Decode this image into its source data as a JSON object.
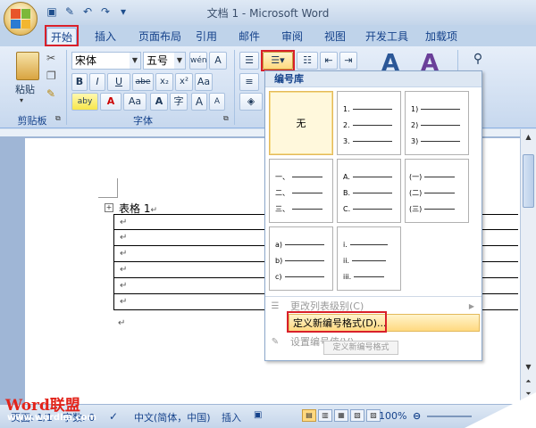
{
  "title": "文档 1 - Microsoft Word",
  "tabs": [
    "开始",
    "插入",
    "页面布局",
    "引用",
    "邮件",
    "审阅",
    "视图",
    "开发工具",
    "加载项"
  ],
  "ribbon": {
    "clipboard": {
      "paste_label": "粘贴",
      "group_label": "剪贴板"
    },
    "font": {
      "font_name": "宋体",
      "font_size": "五号",
      "font_size_menu": "五",
      "bold": "B",
      "italic": "I",
      "underline": "U",
      "strike": "abe",
      "subscript": "x₂",
      "superscript": "x²",
      "clear_format": "Aa",
      "char_border": "A",
      "enclose": "字",
      "grow": "A",
      "shrink": "A",
      "phonetic": "wén",
      "font_color": "A",
      "highlight": "aby",
      "group_label": "字体"
    }
  },
  "dropdown": {
    "header": "编号库",
    "none_label": "无",
    "tiles": [
      [
        "1.",
        "2.",
        "3."
      ],
      [
        "1)",
        "2)",
        "3)"
      ],
      [
        "一、",
        "二、",
        "三、"
      ],
      [
        "A.",
        "B.",
        "C."
      ],
      [
        "(一)",
        "(二)",
        "(三)"
      ],
      [
        "a)",
        "b)",
        "c)"
      ],
      [
        "i.",
        "ii.",
        "iii."
      ]
    ],
    "change_level": "更改列表级别(C)",
    "define_new": "定义新编号格式(D)...",
    "set_value": "设置编号值(V)...",
    "ghost_tooltip": "定义新编号格式"
  },
  "document": {
    "caption": "表格 1",
    "row_mark": "↵",
    "anchor_mark": "+"
  },
  "statusbar": {
    "page": "页面: 1/1",
    "words": "字数: 0",
    "language": "中文(简体，中国)",
    "mode": "插入",
    "zoom": "100%"
  },
  "watermark": {
    "brand": "Word联盟",
    "url": "www.wordlm.com"
  },
  "colors": {
    "accent_red": "#d9202a",
    "ribbon_blue": "#15428b",
    "highlight": "#ffd980"
  }
}
